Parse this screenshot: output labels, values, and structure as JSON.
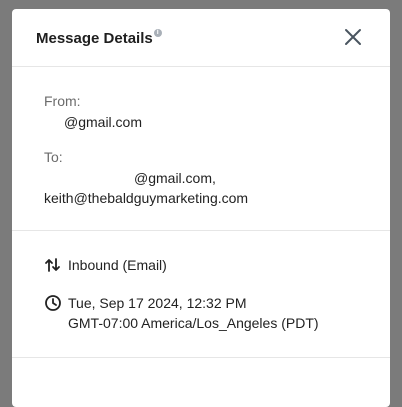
{
  "modal": {
    "title": "Message Details",
    "info_glyph": "i",
    "close_icon": "close-icon"
  },
  "from": {
    "label": "From:",
    "value": "@gmail.com"
  },
  "to": {
    "label": "To:",
    "recipients": [
      "@gmail.com,",
      "keith@thebaldguymarketing.com"
    ]
  },
  "direction": {
    "icon": "arrows-up-down-icon",
    "text": "Inbound (Email)"
  },
  "timestamp": {
    "icon": "clock-icon",
    "line1": "Tue, Sep 17 2024, 12:32 PM",
    "line2": "GMT-07:00 America/Los_Angeles (PDT)"
  }
}
